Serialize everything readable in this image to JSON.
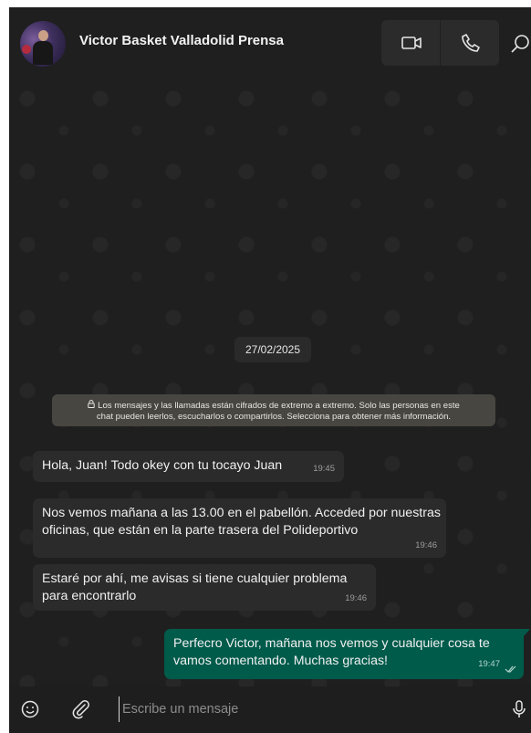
{
  "header": {
    "chat_title": "Victor Basket Valladolid Prensa",
    "avatar_icon": "contact-photo",
    "video_icon": "video-camera-icon",
    "phone_icon": "phone-icon",
    "search_icon": "search-icon"
  },
  "chat": {
    "date_separator": "27/02/2025",
    "encryption_notice": {
      "icon": "lock-icon",
      "line1": "Los mensajes y las llamadas están cifrados de extremo a extremo. Solo las personas en este",
      "line2": "chat pueden leerlos, escucharlos o compartirlos. Selecciona para obtener más información."
    },
    "messages": [
      {
        "direction": "incoming",
        "text": "Hola, Juan! Todo okey con tu tocayo Juan",
        "time": "19:45"
      },
      {
        "direction": "incoming",
        "text": "Nos vemos mañana a las 13.00 en el pabellón. Acceded por nuestras oficinas, que están en la parte trasera del Polideportivo",
        "time": "19:46"
      },
      {
        "direction": "incoming",
        "text": "Estaré por ahí, me avisas si tiene cualquier problema para encontrarlo",
        "time": "19:46"
      },
      {
        "direction": "outgoing",
        "text": "Perfecro Victor, mañana nos vemos y cualquier cosa te vamos comentando. Muchas gracias!",
        "time": "19:47",
        "status": "read"
      }
    ]
  },
  "composer": {
    "placeholder": "Escribe un mensaje",
    "emoji_icon": "emoji-icon",
    "attach_icon": "paperclip-icon",
    "mic_icon": "microphone-icon"
  },
  "colors": {
    "background": "#1e1e1e",
    "incoming_bubble": "#2b2b2b",
    "outgoing_bubble": "#005b4b",
    "notice_bg": "#484640"
  }
}
